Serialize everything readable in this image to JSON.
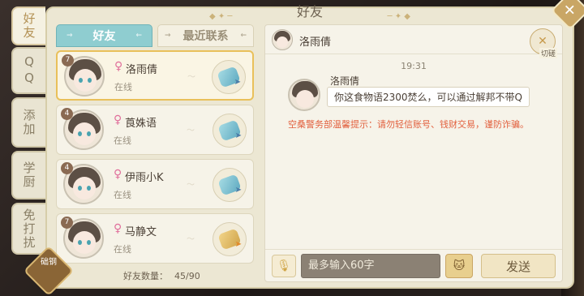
{
  "panel": {
    "title": "好友"
  },
  "side_tabs": [
    {
      "label": "好友",
      "active": true
    },
    {
      "label": "QQ",
      "active": false
    },
    {
      "label": "添加",
      "active": false
    },
    {
      "label": "学厨",
      "active": false
    },
    {
      "label": "免打扰",
      "active": false
    }
  ],
  "list_tabs": {
    "friends": "好友",
    "recent": "最近联系"
  },
  "friends": [
    {
      "level": "7",
      "gender_icon": "♀",
      "name": "洛雨倩",
      "status": "在线",
      "hand_color": "blue"
    },
    {
      "level": "4",
      "gender_icon": "♀",
      "name": "莨姝语",
      "status": "在线",
      "hand_color": "blue"
    },
    {
      "level": "4",
      "gender_icon": "♀",
      "name": "伊雨小K",
      "status": "在线",
      "hand_color": "blue"
    },
    {
      "level": "7",
      "gender_icon": "♀",
      "name": "马静文",
      "status": "在线",
      "hand_color": "gold"
    }
  ],
  "friend_count": {
    "label": "好友数量：",
    "value": "45/90"
  },
  "chat": {
    "header_name": "洛雨倩",
    "switch_label": "切磋",
    "time": "19:31",
    "message": {
      "sender": "洛雨倩",
      "text": "你这食物语2300焚么，可以通过解邦不带Q"
    },
    "warning": "空桑警务部温馨提示：请勿轻信账号、钱财交易，谨防诈骗。"
  },
  "input": {
    "placeholder": "最多输入60字",
    "send_label": "发送"
  },
  "corner_badge": {
    "text": "础钢"
  },
  "colors": {
    "panel_bg": "#ece7d3",
    "tab_active": "#8fcdd0",
    "gold_accent": "#e9c05a",
    "warning": "#e2603e",
    "female": "#e06f9b"
  }
}
